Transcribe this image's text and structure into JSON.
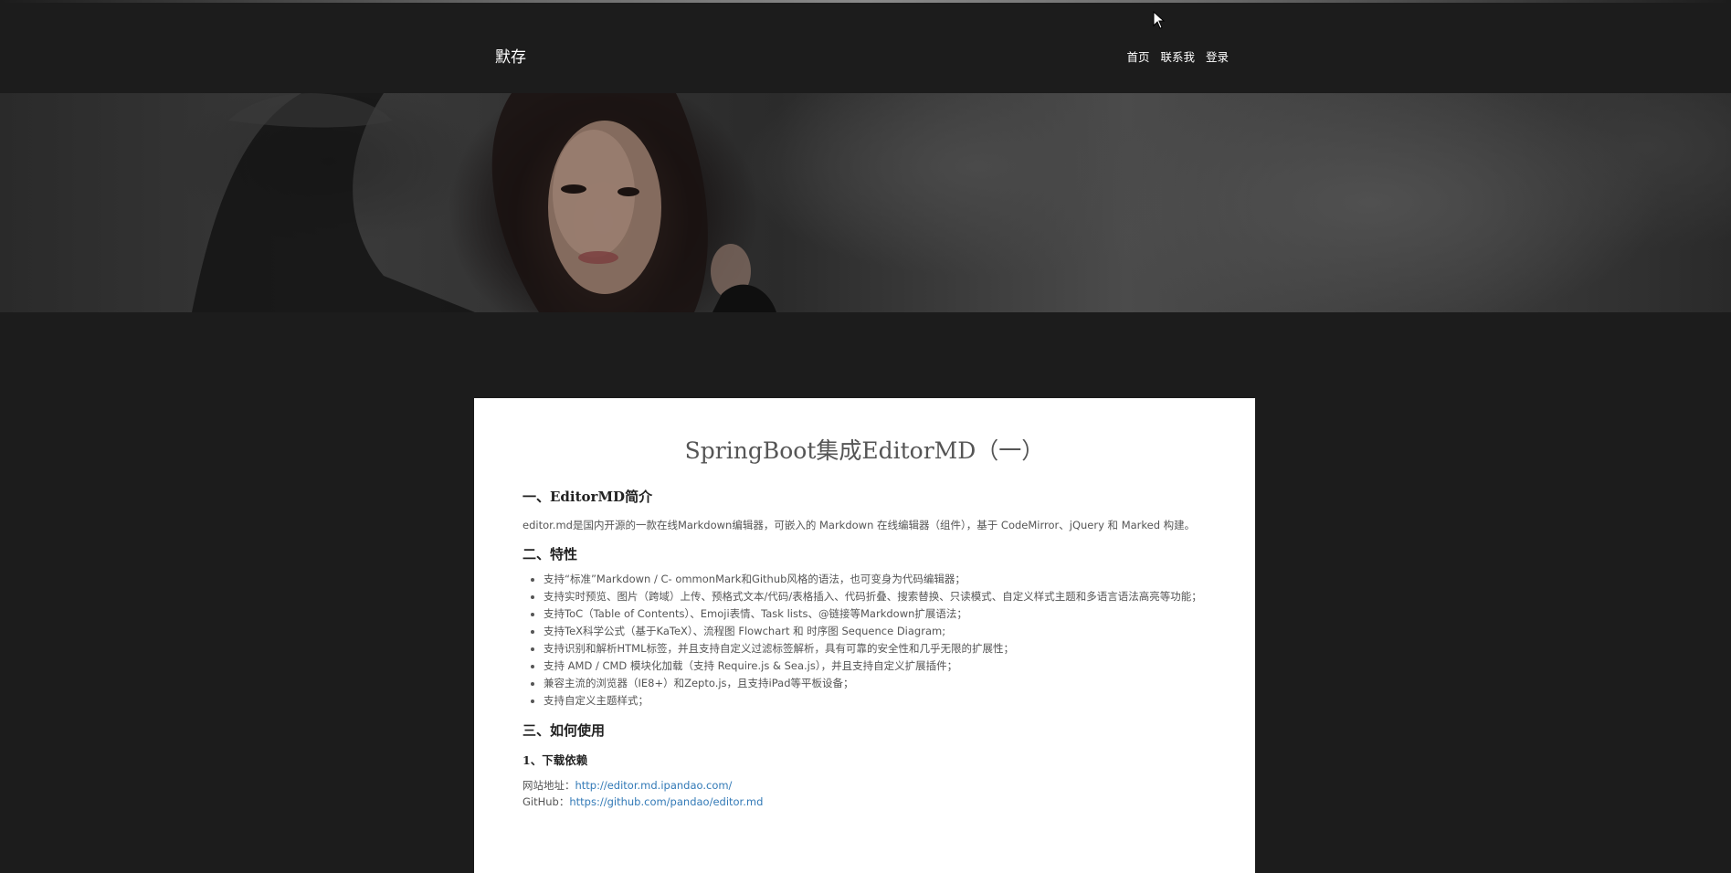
{
  "navbar": {
    "brand": "默存",
    "menu": [
      "首页",
      "联系我",
      "登录"
    ]
  },
  "post": {
    "title": "SpringBoot集成EditorMD（一）",
    "sections": [
      {
        "heading": "一、EditorMD简介",
        "paragraph": "editor.md是国内开源的一款在线Markdown编辑器，可嵌入的 Markdown 在线编辑器（组件），基于 CodeMirror、jQuery 和 Marked 构建。"
      },
      {
        "heading": "二、特性",
        "items": [
          "支持“标准”Markdown / C- ommonMark和Github风格的语法，也可变身为代码编辑器；",
          "支持实时预览、图片（跨域）上传、预格式文本/代码/表格插入、代码折叠、搜索替换、只读模式、自定义样式主题和多语言语法高亮等功能；",
          "支持ToC（Table of Contents）、Emoji表情、Task lists、@链接等Markdown扩展语法；",
          "支持TeX科学公式（基于KaTeX）、流程图 Flowchart 和 时序图 Sequence Diagram;",
          "支持识别和解析HTML标签，并且支持自定义过滤标签解析，具有可靠的安全性和几乎无限的扩展性；",
          "支持 AMD / CMD 模块化加载（支持 Require.js & Sea.js），并且支持自定义扩展插件；",
          "兼容主流的浏览器（IE8+）和Zepto.js，且支持iPad等平板设备；",
          "支持自定义主题样式；"
        ]
      },
      {
        "heading": "三、如何使用",
        "subheading": "1、下载依赖",
        "links": [
          {
            "label": "网站地址：",
            "url": "http://editor.md.ipandao.com/"
          },
          {
            "label": "GitHub：",
            "url": "https://github.com/pandao/editor.md"
          }
        ]
      }
    ]
  },
  "colors": {
    "background": "#1c1c1c",
    "card": "#ffffff",
    "link": "#337ab7"
  }
}
